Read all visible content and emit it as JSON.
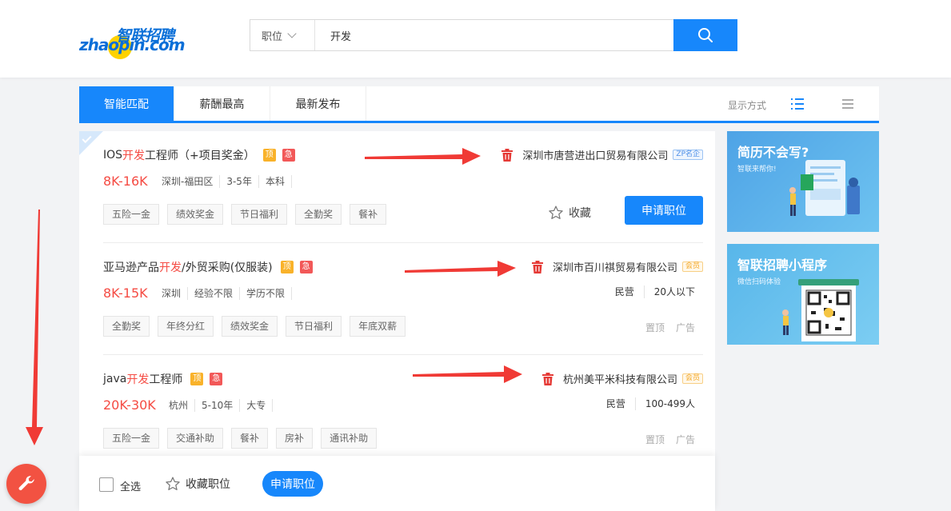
{
  "header": {
    "logo_cn": "智联招聘",
    "logo_en": "zhaopin.com",
    "search": {
      "type_label": "职位",
      "query": "开发"
    }
  },
  "tabs": [
    {
      "label": "智能匹配",
      "active": true
    },
    {
      "label": "薪酬最高",
      "active": false
    },
    {
      "label": "最新发布",
      "active": false
    }
  ],
  "view": {
    "label": "显示方式"
  },
  "jobs": [
    {
      "title_pre": "IOS",
      "title_hl": "开发",
      "title_post": "工程师（+项目奖金）",
      "tag_ding": "顶",
      "tag_ji": "急",
      "salary": "8K-16K",
      "reqs": [
        "深圳-福田区",
        "3-5年",
        "本科"
      ],
      "welfare": [
        "五险一金",
        "绩效奖金",
        "节日福利",
        "全勤奖",
        "餐补"
      ],
      "company": "深圳市唐营进出口贸易有限公司",
      "badge": "ZP名企",
      "fav_label": "收藏",
      "apply_label": "申请职位"
    },
    {
      "title_pre": "亚马逊产品",
      "title_hl": "开发",
      "title_post": "/外贸采购(仅服装)",
      "tag_ding": "顶",
      "tag_ji": "急",
      "salary": "8K-15K",
      "reqs": [
        "深圳",
        "经验不限",
        "学历不限"
      ],
      "welfare": [
        "全勤奖",
        "年终分红",
        "绩效奖金",
        "节日福利",
        "年底双薪"
      ],
      "company": "深圳市百川祺贸易有限公司",
      "badge": "会员",
      "comp_info": [
        "民营",
        "20人以下"
      ],
      "ad_links": [
        "置顶",
        "广告"
      ]
    },
    {
      "title_pre": "java",
      "title_hl": "开发",
      "title_post": "工程师",
      "tag_ding": "顶",
      "tag_ji": "急",
      "salary": "20K-30K",
      "reqs": [
        "杭州",
        "5-10年",
        "大专"
      ],
      "welfare": [
        "五险一金",
        "交通补助",
        "餐补",
        "房补",
        "通讯补助"
      ],
      "company": "杭州美平米科技有限公司",
      "badge": "会员",
      "comp_info": [
        "民营",
        "100-499人"
      ],
      "ad_links": [
        "置顶",
        "广告"
      ]
    }
  ],
  "bottom_bar": {
    "select_all": "全选",
    "fav": "收藏职位",
    "apply": "申请职位"
  },
  "banners": [
    {
      "title": "简历不会写?",
      "sub": "智联来帮你!"
    },
    {
      "title": "智联招聘小程序",
      "sub": "微信扫码体验"
    }
  ],
  "colors": {
    "accent": "#1787fb",
    "highlight": "#f54b43",
    "ding": "#f9b22a",
    "ji": "#f25858",
    "arrow": "#f03a35"
  }
}
